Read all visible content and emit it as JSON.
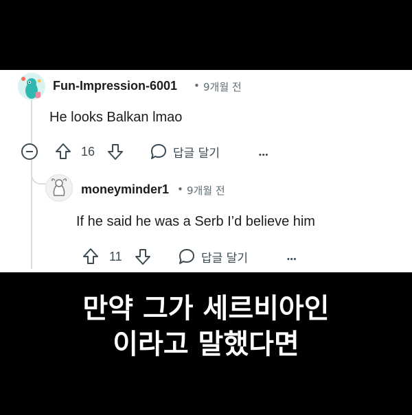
{
  "comment": {
    "username": "Fun-Impression-6001",
    "separator": "•",
    "time": "9개월 전",
    "text": "He looks Balkan lmao",
    "upvotes": "16",
    "reply_label": "답글 달기",
    "more": "•••"
  },
  "reply": {
    "username": "moneyminder1",
    "separator": "•",
    "time": "9개월 전",
    "text": "If he said he was a Serb I’d believe him",
    "upvotes": "11",
    "reply_label": "답글 달기",
    "more": "•••"
  },
  "caption": {
    "line1": "만약 그가 세르비아인",
    "line2": "이라고 말했다면"
  },
  "colors": {
    "background": "#000000",
    "panel": "#ffffff",
    "text": "#1c1c1c",
    "muted": "#5c6c74"
  },
  "icons": [
    "collapse-icon",
    "upvote-icon",
    "downvote-icon",
    "reply-bubble-icon",
    "more-icon"
  ]
}
